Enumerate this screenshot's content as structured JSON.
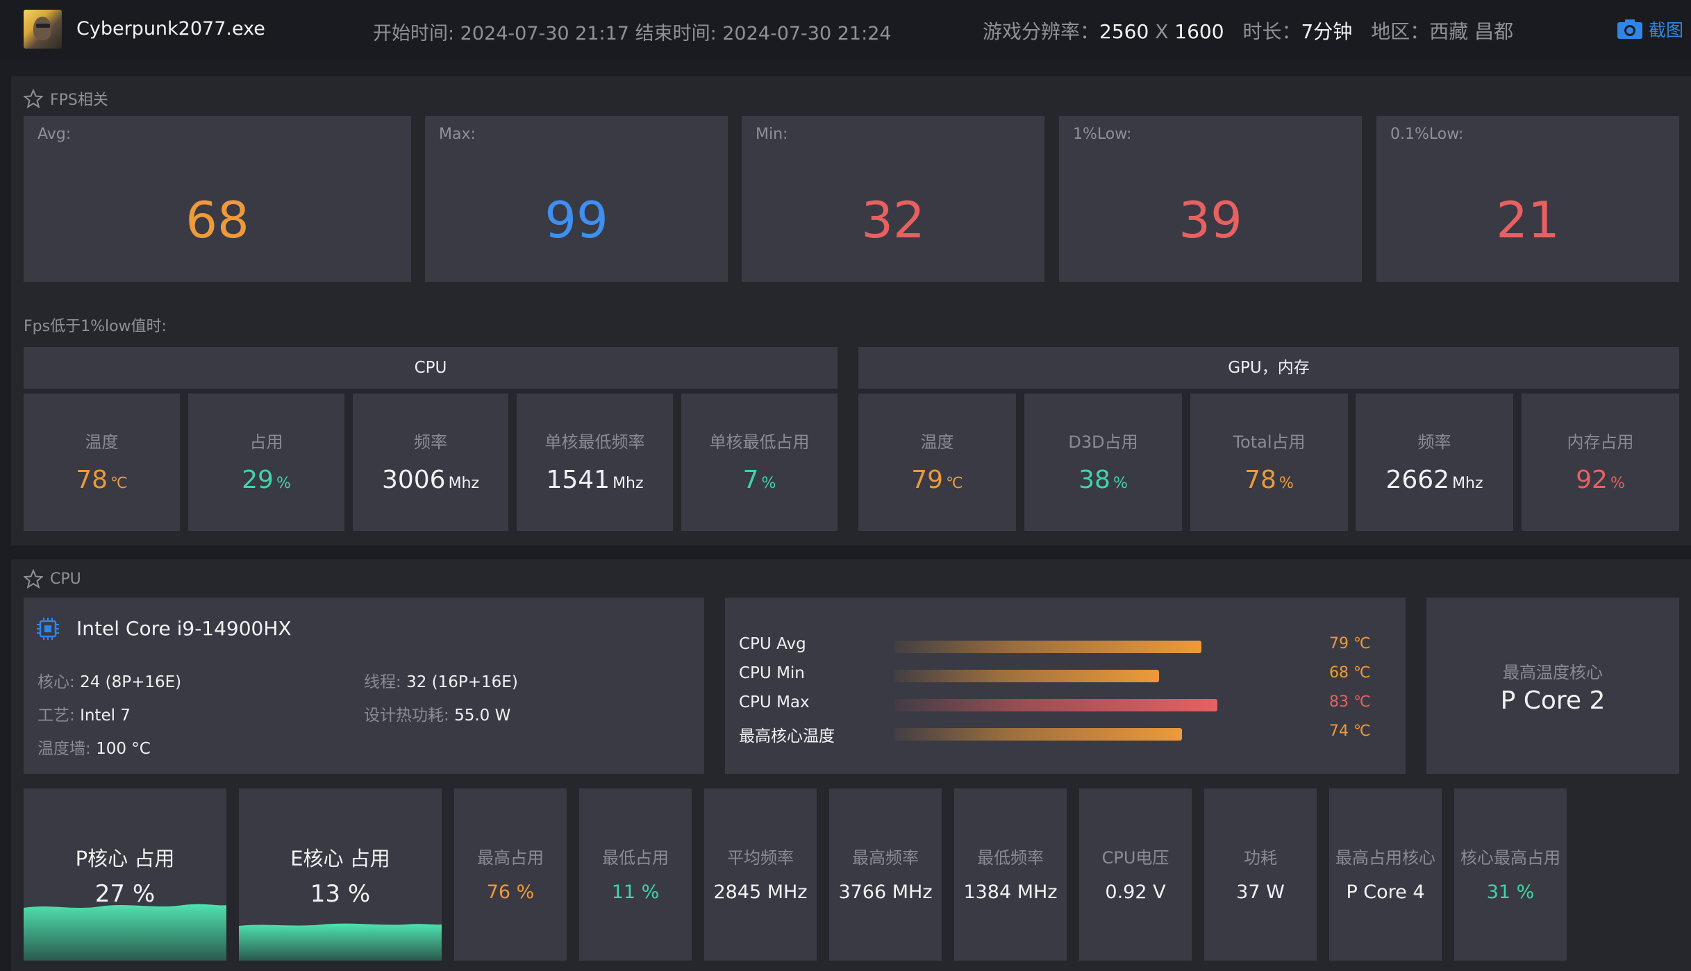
{
  "header": {
    "exe_name": "Cyberpunk2077.exe",
    "time_text": "开始时间: 2024-07-30 21:17 结束时间: 2024-07-30 21:24",
    "resolution_label": "游戏分辨率：",
    "resolution_w": "2560",
    "resolution_x": "X",
    "resolution_h": "1600",
    "duration_label": "时长：",
    "duration_value": "7分钟",
    "region_label": "地区：",
    "region_value": "西藏 昌都",
    "screenshot_label": "截图"
  },
  "fps_section": {
    "title": "FPS相关",
    "cards": [
      {
        "label": "Avg:",
        "value": "68",
        "color": "#ee9a3a"
      },
      {
        "label": "Max:",
        "value": "99",
        "color": "#3e8ff0"
      },
      {
        "label": "Min:",
        "value": "32",
        "color": "#e96060"
      },
      {
        "label": "1%Low:",
        "value": "39",
        "color": "#e96060"
      },
      {
        "label": "0.1%Low:",
        "value": "21",
        "color": "#e96060"
      }
    ],
    "sub_label": "Fps低于1%low值时:",
    "cpu_group": {
      "title": "CPU",
      "stats": [
        {
          "label": "温度",
          "value": "78",
          "unit": "℃"
        },
        {
          "label": "占用",
          "value": "29",
          "unit": "%"
        },
        {
          "label": "频率",
          "value": "3006",
          "unit": "Mhz"
        },
        {
          "label": "单核最低频率",
          "value": "1541",
          "unit": "Mhz"
        },
        {
          "label": "单核最低占用",
          "value": "7",
          "unit": "%"
        }
      ]
    },
    "gpu_group": {
      "title": "GPU，内存",
      "stats": [
        {
          "label": "温度",
          "value": "79",
          "unit": "℃"
        },
        {
          "label": "D3D占用",
          "value": "38",
          "unit": "%"
        },
        {
          "label": "Total占用",
          "value": "78",
          "unit": "%"
        },
        {
          "label": "频率",
          "value": "2662",
          "unit": "Mhz"
        },
        {
          "label": "内存占用",
          "value": "92",
          "unit": "%"
        }
      ]
    }
  },
  "cpu_section": {
    "title": "CPU",
    "name": "Intel Core i9-14900HX",
    "cores_label": "核心:",
    "cores_value": "24 (8P+16E)",
    "threads_label": "线程:",
    "threads_value": "32 (16P+16E)",
    "process_label": "工艺:",
    "process_value": "Intel 7",
    "tdp_label": "设计热功耗:",
    "tdp_value": "55.0 W",
    "tjmax_label": "温度墙:",
    "tjmax_value": "100 °C",
    "temps": [
      {
        "name": "CPU Avg",
        "value": "79 ℃",
        "temp": 79
      },
      {
        "name": "CPU Min",
        "value": "68 ℃",
        "temp": 68
      },
      {
        "name": "CPU Max",
        "value": "83 ℃",
        "temp": 83
      },
      {
        "name": "最高核心温度",
        "value": "74 ℃",
        "temp": 74
      }
    ],
    "hottest_core_label": "最高温度核心",
    "hottest_core_value": "P Core 2",
    "p_core_label": "P核心 占用",
    "p_core_value": "27 %",
    "e_core_label": "E核心 占用",
    "e_core_value": "13 %",
    "metrics": [
      {
        "label": "最高占用",
        "value": "76 %"
      },
      {
        "label": "最低占用",
        "value": "11 %"
      },
      {
        "label": "平均频率",
        "value": "2845 MHz"
      },
      {
        "label": "最高频率",
        "value": "3766 MHz"
      },
      {
        "label": "最低频率",
        "value": "1384 MHz"
      },
      {
        "label": "CPU电压",
        "value": "0.92 V"
      },
      {
        "label": "功耗",
        "value": "37 W"
      },
      {
        "label": "最高占用核心",
        "value": "P Core 4"
      },
      {
        "label": "核心最高占用",
        "value": "31 %"
      }
    ]
  },
  "colors": {
    "orange": "#ee9a3a",
    "green": "#3fd6a6",
    "red": "#e96060",
    "blue": "#3e8ff0",
    "card_bg": "#393a44",
    "panel_bg": "#26272d"
  }
}
